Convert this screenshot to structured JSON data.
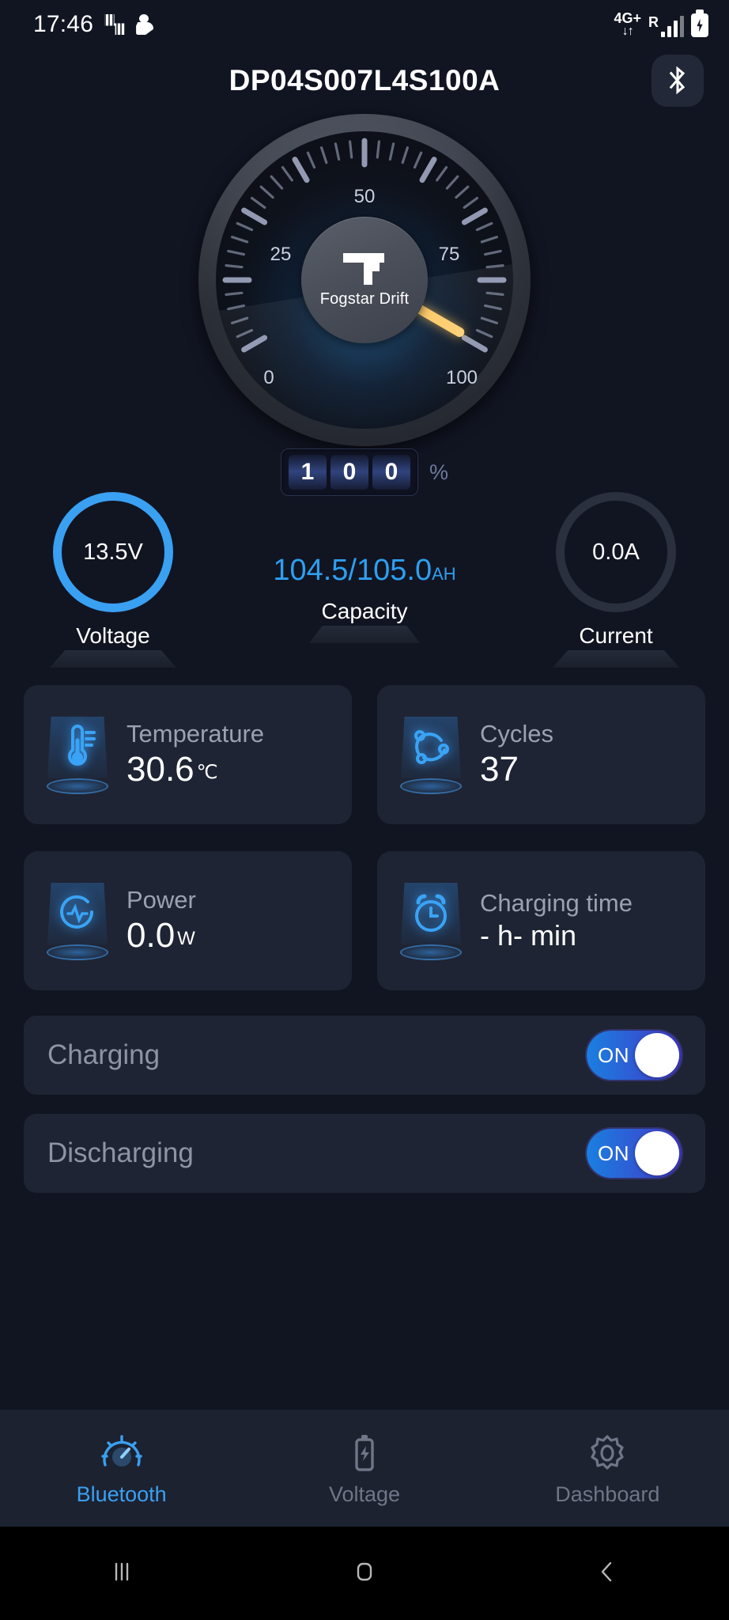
{
  "status_bar": {
    "time": "17:46",
    "left_icons": [
      "app-notification-icon",
      "app-notification-icon-2"
    ],
    "network_label": "4G+",
    "network_arrows": "↓↑",
    "roaming": "R",
    "signal_icon": "signal-bars-icon",
    "battery_icon": "battery-charging-icon"
  },
  "header": {
    "title": "DP04S007L4S100A",
    "bluetooth_icon": "bluetooth-icon"
  },
  "gauge": {
    "brand": "Fogstar Drift",
    "brand_logo": "fogstar-f-logo",
    "tick_labels": [
      "0",
      "25",
      "50",
      "75",
      "100"
    ],
    "min": 0,
    "max": 100,
    "value": 100,
    "needle_color": "#f4bd52",
    "odometer_digits": [
      "1",
      "0",
      "0"
    ],
    "unit": "%"
  },
  "metrics": {
    "voltage": {
      "value": "13.5V",
      "label": "Voltage",
      "ring_color": "#3aa0f2",
      "active": true
    },
    "capacity": {
      "value": "104.5/105.0",
      "unit": "AH",
      "label": "Capacity",
      "color": "#2e9ff0"
    },
    "current": {
      "value": "0.0A",
      "label": "Current",
      "ring_color": "#2a303d",
      "active": false
    }
  },
  "cards": [
    {
      "icon": "thermometer-icon",
      "title": "Temperature",
      "value": "30.6",
      "unit": "℃"
    },
    {
      "icon": "cycles-icon",
      "title": "Cycles",
      "value": "37",
      "unit": ""
    },
    {
      "icon": "power-pulse-icon",
      "title": "Power",
      "value": "0.0",
      "unit": "W"
    },
    {
      "icon": "alarm-clock-icon",
      "title": "Charging time",
      "value": "- h- min",
      "unit": ""
    }
  ],
  "switches": [
    {
      "label": "Charging",
      "state": "ON"
    },
    {
      "label": "Discharging",
      "state": "ON"
    }
  ],
  "bottom_nav": [
    {
      "icon": "gauge-icon",
      "label": "Bluetooth",
      "active": true
    },
    {
      "icon": "battery-bolt-icon",
      "label": "Voltage",
      "active": false
    },
    {
      "icon": "gear-icon",
      "label": "Dashboard",
      "active": false
    }
  ],
  "system_nav": [
    {
      "icon": "recents-icon"
    },
    {
      "icon": "home-icon"
    },
    {
      "icon": "back-icon"
    }
  ]
}
